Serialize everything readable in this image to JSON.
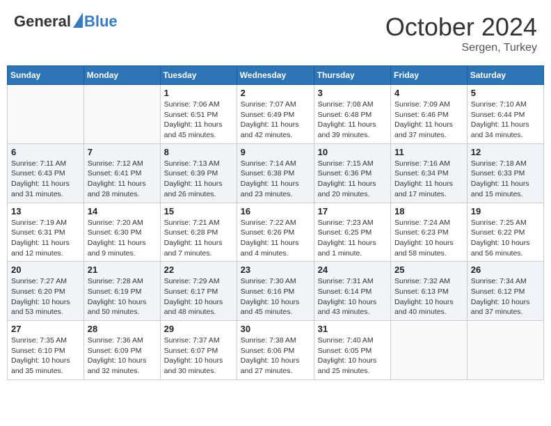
{
  "header": {
    "logo_general": "General",
    "logo_blue": "Blue",
    "month": "October 2024",
    "location": "Sergen, Turkey"
  },
  "days_of_week": [
    "Sunday",
    "Monday",
    "Tuesday",
    "Wednesday",
    "Thursday",
    "Friday",
    "Saturday"
  ],
  "weeks": [
    [
      {
        "day": "",
        "sunrise": "",
        "sunset": "",
        "daylight": ""
      },
      {
        "day": "",
        "sunrise": "",
        "sunset": "",
        "daylight": ""
      },
      {
        "day": "1",
        "sunrise": "Sunrise: 7:06 AM",
        "sunset": "Sunset: 6:51 PM",
        "daylight": "Daylight: 11 hours and 45 minutes."
      },
      {
        "day": "2",
        "sunrise": "Sunrise: 7:07 AM",
        "sunset": "Sunset: 6:49 PM",
        "daylight": "Daylight: 11 hours and 42 minutes."
      },
      {
        "day": "3",
        "sunrise": "Sunrise: 7:08 AM",
        "sunset": "Sunset: 6:48 PM",
        "daylight": "Daylight: 11 hours and 39 minutes."
      },
      {
        "day": "4",
        "sunrise": "Sunrise: 7:09 AM",
        "sunset": "Sunset: 6:46 PM",
        "daylight": "Daylight: 11 hours and 37 minutes."
      },
      {
        "day": "5",
        "sunrise": "Sunrise: 7:10 AM",
        "sunset": "Sunset: 6:44 PM",
        "daylight": "Daylight: 11 hours and 34 minutes."
      }
    ],
    [
      {
        "day": "6",
        "sunrise": "Sunrise: 7:11 AM",
        "sunset": "Sunset: 6:43 PM",
        "daylight": "Daylight: 11 hours and 31 minutes."
      },
      {
        "day": "7",
        "sunrise": "Sunrise: 7:12 AM",
        "sunset": "Sunset: 6:41 PM",
        "daylight": "Daylight: 11 hours and 28 minutes."
      },
      {
        "day": "8",
        "sunrise": "Sunrise: 7:13 AM",
        "sunset": "Sunset: 6:39 PM",
        "daylight": "Daylight: 11 hours and 26 minutes."
      },
      {
        "day": "9",
        "sunrise": "Sunrise: 7:14 AM",
        "sunset": "Sunset: 6:38 PM",
        "daylight": "Daylight: 11 hours and 23 minutes."
      },
      {
        "day": "10",
        "sunrise": "Sunrise: 7:15 AM",
        "sunset": "Sunset: 6:36 PM",
        "daylight": "Daylight: 11 hours and 20 minutes."
      },
      {
        "day": "11",
        "sunrise": "Sunrise: 7:16 AM",
        "sunset": "Sunset: 6:34 PM",
        "daylight": "Daylight: 11 hours and 17 minutes."
      },
      {
        "day": "12",
        "sunrise": "Sunrise: 7:18 AM",
        "sunset": "Sunset: 6:33 PM",
        "daylight": "Daylight: 11 hours and 15 minutes."
      }
    ],
    [
      {
        "day": "13",
        "sunrise": "Sunrise: 7:19 AM",
        "sunset": "Sunset: 6:31 PM",
        "daylight": "Daylight: 11 hours and 12 minutes."
      },
      {
        "day": "14",
        "sunrise": "Sunrise: 7:20 AM",
        "sunset": "Sunset: 6:30 PM",
        "daylight": "Daylight: 11 hours and 9 minutes."
      },
      {
        "day": "15",
        "sunrise": "Sunrise: 7:21 AM",
        "sunset": "Sunset: 6:28 PM",
        "daylight": "Daylight: 11 hours and 7 minutes."
      },
      {
        "day": "16",
        "sunrise": "Sunrise: 7:22 AM",
        "sunset": "Sunset: 6:26 PM",
        "daylight": "Daylight: 11 hours and 4 minutes."
      },
      {
        "day": "17",
        "sunrise": "Sunrise: 7:23 AM",
        "sunset": "Sunset: 6:25 PM",
        "daylight": "Daylight: 11 hours and 1 minute."
      },
      {
        "day": "18",
        "sunrise": "Sunrise: 7:24 AM",
        "sunset": "Sunset: 6:23 PM",
        "daylight": "Daylight: 10 hours and 58 minutes."
      },
      {
        "day": "19",
        "sunrise": "Sunrise: 7:25 AM",
        "sunset": "Sunset: 6:22 PM",
        "daylight": "Daylight: 10 hours and 56 minutes."
      }
    ],
    [
      {
        "day": "20",
        "sunrise": "Sunrise: 7:27 AM",
        "sunset": "Sunset: 6:20 PM",
        "daylight": "Daylight: 10 hours and 53 minutes."
      },
      {
        "day": "21",
        "sunrise": "Sunrise: 7:28 AM",
        "sunset": "Sunset: 6:19 PM",
        "daylight": "Daylight: 10 hours and 50 minutes."
      },
      {
        "day": "22",
        "sunrise": "Sunrise: 7:29 AM",
        "sunset": "Sunset: 6:17 PM",
        "daylight": "Daylight: 10 hours and 48 minutes."
      },
      {
        "day": "23",
        "sunrise": "Sunrise: 7:30 AM",
        "sunset": "Sunset: 6:16 PM",
        "daylight": "Daylight: 10 hours and 45 minutes."
      },
      {
        "day": "24",
        "sunrise": "Sunrise: 7:31 AM",
        "sunset": "Sunset: 6:14 PM",
        "daylight": "Daylight: 10 hours and 43 minutes."
      },
      {
        "day": "25",
        "sunrise": "Sunrise: 7:32 AM",
        "sunset": "Sunset: 6:13 PM",
        "daylight": "Daylight: 10 hours and 40 minutes."
      },
      {
        "day": "26",
        "sunrise": "Sunrise: 7:34 AM",
        "sunset": "Sunset: 6:12 PM",
        "daylight": "Daylight: 10 hours and 37 minutes."
      }
    ],
    [
      {
        "day": "27",
        "sunrise": "Sunrise: 7:35 AM",
        "sunset": "Sunset: 6:10 PM",
        "daylight": "Daylight: 10 hours and 35 minutes."
      },
      {
        "day": "28",
        "sunrise": "Sunrise: 7:36 AM",
        "sunset": "Sunset: 6:09 PM",
        "daylight": "Daylight: 10 hours and 32 minutes."
      },
      {
        "day": "29",
        "sunrise": "Sunrise: 7:37 AM",
        "sunset": "Sunset: 6:07 PM",
        "daylight": "Daylight: 10 hours and 30 minutes."
      },
      {
        "day": "30",
        "sunrise": "Sunrise: 7:38 AM",
        "sunset": "Sunset: 6:06 PM",
        "daylight": "Daylight: 10 hours and 27 minutes."
      },
      {
        "day": "31",
        "sunrise": "Sunrise: 7:40 AM",
        "sunset": "Sunset: 6:05 PM",
        "daylight": "Daylight: 10 hours and 25 minutes."
      },
      {
        "day": "",
        "sunrise": "",
        "sunset": "",
        "daylight": ""
      },
      {
        "day": "",
        "sunrise": "",
        "sunset": "",
        "daylight": ""
      }
    ]
  ]
}
